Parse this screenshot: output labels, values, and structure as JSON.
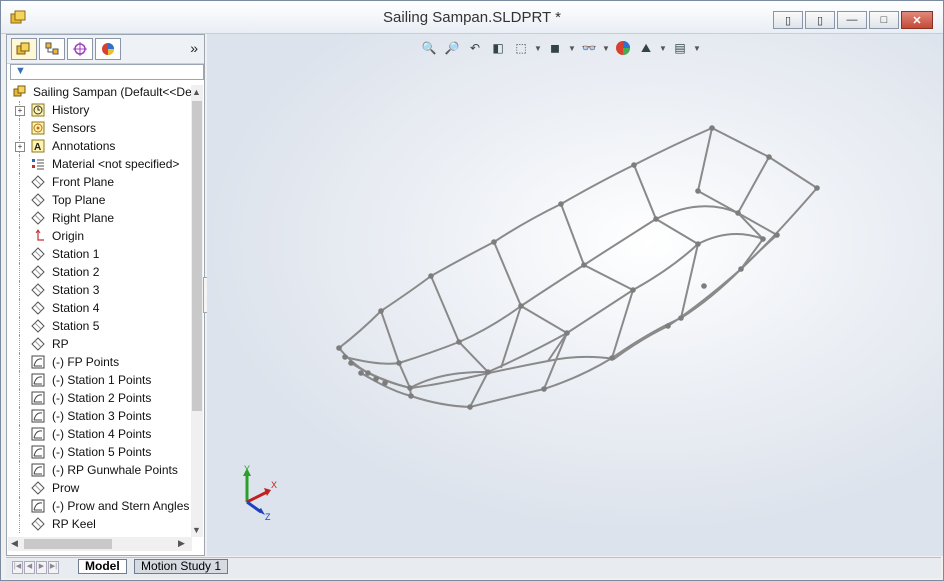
{
  "window": {
    "title": "Sailing Sampan.SLDPRT *",
    "buttons": [
      "restore-left",
      "restore-right",
      "minimize",
      "maximize",
      "close"
    ]
  },
  "feature_manager": {
    "tabs": [
      "feature-manager",
      "property-manager",
      "configuration-manager",
      "display-manager"
    ],
    "expand_label": "»",
    "root_label": "Sailing Sampan  (Default<<De",
    "items": [
      {
        "label": "History",
        "icon": "history-icon",
        "expandable": true
      },
      {
        "label": "Sensors",
        "icon": "sensors-icon",
        "expandable": false
      },
      {
        "label": "Annotations",
        "icon": "annotations-icon",
        "expandable": true
      },
      {
        "label": "Material <not specified>",
        "icon": "material-icon",
        "expandable": false
      },
      {
        "label": "Front Plane",
        "icon": "plane-icon",
        "expandable": false
      },
      {
        "label": "Top Plane",
        "icon": "plane-icon",
        "expandable": false
      },
      {
        "label": "Right Plane",
        "icon": "plane-icon",
        "expandable": false
      },
      {
        "label": "Origin",
        "icon": "origin-icon",
        "expandable": false
      },
      {
        "label": "Station 1",
        "icon": "plane-icon",
        "expandable": false
      },
      {
        "label": "Station 2",
        "icon": "plane-icon",
        "expandable": false
      },
      {
        "label": "Station 3",
        "icon": "plane-icon",
        "expandable": false
      },
      {
        "label": "Station 4",
        "icon": "plane-icon",
        "expandable": false
      },
      {
        "label": "Station 5",
        "icon": "plane-icon",
        "expandable": false
      },
      {
        "label": "RP",
        "icon": "plane-icon",
        "expandable": false
      },
      {
        "label": "(-) FP Points",
        "icon": "sketch-icon",
        "expandable": false
      },
      {
        "label": "(-) Station 1 Points",
        "icon": "sketch-icon",
        "expandable": false
      },
      {
        "label": "(-) Station 2 Points",
        "icon": "sketch-icon",
        "expandable": false
      },
      {
        "label": "(-) Station 3 Points",
        "icon": "sketch-icon",
        "expandable": false
      },
      {
        "label": "(-) Station 4 Points",
        "icon": "sketch-icon",
        "expandable": false
      },
      {
        "label": "(-) Station 5 Points",
        "icon": "sketch-icon",
        "expandable": false
      },
      {
        "label": "(-) RP Gunwhale Points",
        "icon": "sketch-icon",
        "expandable": false
      },
      {
        "label": "Prow",
        "icon": "plane-icon",
        "expandable": false
      },
      {
        "label": "(-) Prow and Stern Angles",
        "icon": "sketch-icon",
        "expandable": false
      },
      {
        "label": "RP Keel",
        "icon": "plane-icon",
        "expandable": false
      }
    ]
  },
  "view_toolbar": [
    "zoom-to-fit-icon",
    "zoom-to-area-icon",
    "previous-view-icon",
    "section-view-icon",
    "view-orientation-icon",
    "display-style-icon",
    "hide-show-icon",
    "edit-appearance-icon",
    "apply-scene-icon",
    "view-settings-icon"
  ],
  "triad": {
    "x": "X",
    "y": "Y",
    "z": "Z"
  },
  "bottom_tabs": [
    {
      "label": "Model",
      "active": true
    },
    {
      "label": "Motion Study 1",
      "active": false
    }
  ],
  "colors": {
    "wire": "#8a8a8a",
    "vertex": "#7d7d7d",
    "viewport_bg": "#e8ecf2"
  }
}
